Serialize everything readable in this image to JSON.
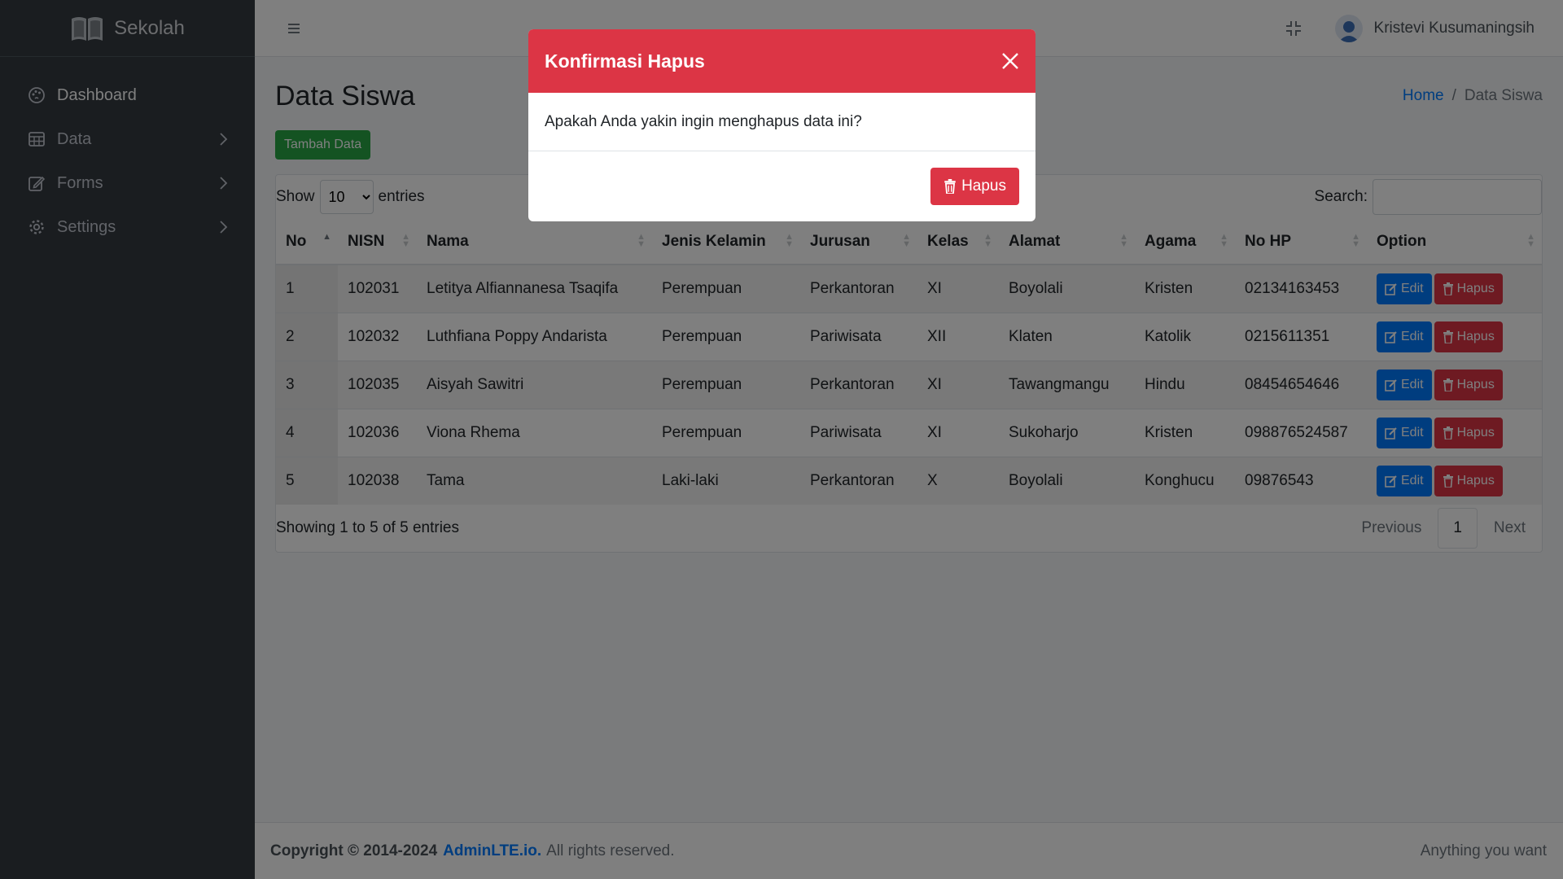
{
  "brand": {
    "name": "Sekolah",
    "icon": "book-open-icon"
  },
  "sidebar": {
    "items": [
      {
        "label": "Dashboard",
        "icon": "palette-icon",
        "active": true
      },
      {
        "label": "Data",
        "icon": "table-icon",
        "has_children": true
      },
      {
        "label": "Forms",
        "icon": "pencil-square-icon",
        "has_children": true
      },
      {
        "label": "Settings",
        "icon": "gear-icon",
        "has_children": true
      }
    ]
  },
  "header": {
    "menu_icon": "hamburger-icon",
    "fullscreen_icon": "fullscreen-exit-icon",
    "user_name": "Kristevi Kusumaningsih"
  },
  "page": {
    "title": "Data Siswa",
    "breadcrumb": {
      "home": "Home",
      "separator": "/",
      "current": "Data Siswa"
    },
    "add_button": "Tambah Data"
  },
  "table": {
    "length_label_before": "Show",
    "length_value": "10",
    "length_label_after": "entries",
    "search_label": "Search:",
    "search_value": "",
    "columns": [
      "No",
      "NISN",
      "Nama",
      "Jenis Kelamin",
      "Jurusan",
      "Kelas",
      "Alamat",
      "Agama",
      "No HP",
      "Option"
    ],
    "rows": [
      {
        "no": "1",
        "nisn": "102031",
        "nama": "Letitya Alfiannanesa Tsaqifa",
        "jk": "Perempuan",
        "jurusan": "Perkantoran",
        "kelas": "XI",
        "alamat": "Boyolali",
        "agama": "Kristen",
        "hp": "02134163453"
      },
      {
        "no": "2",
        "nisn": "102032",
        "nama": "Luthfiana Poppy Andarista",
        "jk": "Perempuan",
        "jurusan": "Pariwisata",
        "kelas": "XII",
        "alamat": "Klaten",
        "agama": "Katolik",
        "hp": "0215611351"
      },
      {
        "no": "3",
        "nisn": "102035",
        "nama": "Aisyah Sawitri",
        "jk": "Perempuan",
        "jurusan": "Perkantoran",
        "kelas": "XI",
        "alamat": "Tawangmangu",
        "agama": "Hindu",
        "hp": "08454654646"
      },
      {
        "no": "4",
        "nisn": "102036",
        "nama": "Viona Rhema",
        "jk": "Perempuan",
        "jurusan": "Pariwisata",
        "kelas": "XI",
        "alamat": "Sukoharjo",
        "agama": "Kristen",
        "hp": "098876524587"
      },
      {
        "no": "5",
        "nisn": "102038",
        "nama": "Tama",
        "jk": "Laki-laki",
        "jurusan": "Perkantoran",
        "kelas": "X",
        "alamat": "Boyolali",
        "agama": "Konghucu",
        "hp": "09876543"
      }
    ],
    "edit_label": "Edit",
    "delete_label": "Hapus",
    "info": "Showing 1 to 5 of 5 entries",
    "pagination": {
      "previous": "Previous",
      "current": "1",
      "next": "Next"
    }
  },
  "footer": {
    "copyright": "Copyright © 2014-2024",
    "link": "AdminLTE.io.",
    "rights": "All rights reserved.",
    "right_text": "Anything you want"
  },
  "modal": {
    "title": "Konfirmasi Hapus",
    "message": "Apakah Anda yakin ingin menghapus data ini?",
    "confirm_label": "Hapus",
    "close_icon": "close-icon"
  },
  "colors": {
    "danger": "#dc3545",
    "primary": "#007bff",
    "success": "#28a745",
    "sidebar": "#343a40"
  }
}
